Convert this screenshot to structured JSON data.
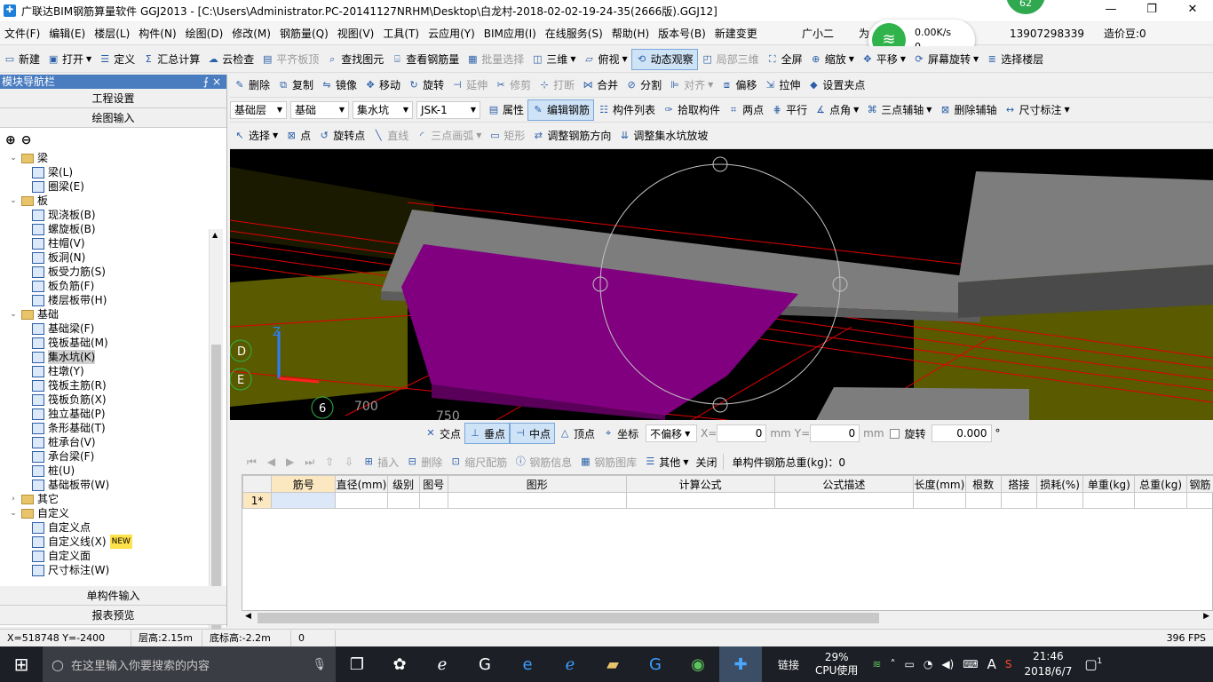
{
  "window": {
    "title": "广联达BIM钢筋算量软件 GGJ2013 - [C:\\Users\\Administrator.PC-20141127NRHM\\Desktop\\白龙村-2018-02-02-19-24-35(2666版).GGJ12]",
    "minimize": "—",
    "restore": "❐",
    "close": "✕",
    "badge": "62"
  },
  "menu": [
    "文件(F)",
    "编辑(E)",
    "楼层(L)",
    "构件(N)",
    "绘图(D)",
    "修改(M)",
    "钢筋量(Q)",
    "视图(V)",
    "工具(T)",
    "云应用(Y)",
    "BIM应用(I)",
    "在线服务(S)",
    "帮助(H)",
    "版本号(B)",
    "新建变更"
  ],
  "menu_right": {
    "user": "广小二",
    "for": "为",
    "phone": "13907298339",
    "cost": "造价豆:0"
  },
  "network": {
    "speed": "0.00K/s",
    "count": "0"
  },
  "toolbar1": [
    {
      "label": "新建",
      "icon": "new-icon"
    },
    {
      "label": "打开",
      "icon": "open-icon",
      "dd": true
    },
    {
      "label": "定义",
      "icon": "define-icon"
    },
    {
      "label": "汇总计算",
      "icon": "sum-icon"
    },
    {
      "label": "云检查",
      "icon": "cloud-check-icon"
    },
    {
      "label": "平齐板顶",
      "icon": "align-top-icon",
      "dis": true
    },
    {
      "label": "查找图元",
      "icon": "find-icon"
    },
    {
      "label": "查看钢筋量",
      "icon": "view-rebar-icon"
    },
    {
      "label": "批量选择",
      "icon": "batch-select-icon",
      "dis": true
    },
    {
      "label": "三维",
      "icon": "3d-icon",
      "dd": true
    },
    {
      "label": "俯视",
      "icon": "top-view-icon",
      "dd": true
    },
    {
      "label": "动态观察",
      "icon": "orbit-icon",
      "active": true
    },
    {
      "label": "局部三维",
      "icon": "local-3d-icon",
      "dis": true
    },
    {
      "label": "全屏",
      "icon": "fullscreen-icon"
    },
    {
      "label": "缩放",
      "icon": "zoom-icon",
      "dd": true
    },
    {
      "label": "平移",
      "icon": "pan-icon",
      "dd": true
    },
    {
      "label": "屏幕旋转",
      "icon": "rotate-screen-icon",
      "dd": true
    },
    {
      "label": "选择楼层",
      "icon": "select-floor-icon"
    }
  ],
  "toolbar2": [
    {
      "label": "删除",
      "icon": "delete-icon"
    },
    {
      "label": "复制",
      "icon": "copy-icon"
    },
    {
      "label": "镜像",
      "icon": "mirror-icon"
    },
    {
      "label": "移动",
      "icon": "move-icon"
    },
    {
      "label": "旋转",
      "icon": "rotate-icon"
    },
    {
      "label": "延伸",
      "icon": "extend-icon",
      "dis": true
    },
    {
      "label": "修剪",
      "icon": "trim-icon",
      "dis": true
    },
    {
      "label": "打断",
      "icon": "break-icon",
      "dis": true
    },
    {
      "label": "合并",
      "icon": "merge-icon"
    },
    {
      "label": "分割",
      "icon": "split-icon"
    },
    {
      "label": "对齐",
      "icon": "align-icon",
      "dis": true,
      "dd": true
    },
    {
      "label": "偏移",
      "icon": "offset-icon"
    },
    {
      "label": "拉伸",
      "icon": "stretch-icon"
    },
    {
      "label": "设置夹点",
      "icon": "grip-icon"
    }
  ],
  "toolbar3": {
    "selects": [
      "基础层",
      "基础",
      "集水坑",
      "JSK-1"
    ],
    "items": [
      {
        "label": "属性",
        "icon": "property-icon"
      },
      {
        "label": "编辑钢筋",
        "icon": "edit-rebar-icon",
        "active": true
      },
      {
        "label": "构件列表",
        "icon": "component-list-icon"
      },
      {
        "label": "拾取构件",
        "icon": "pick-icon"
      },
      {
        "label": "两点",
        "icon": "two-point-icon"
      },
      {
        "label": "平行",
        "icon": "parallel-icon"
      },
      {
        "label": "点角",
        "icon": "point-angle-icon",
        "dd": true
      },
      {
        "label": "三点辅轴",
        "icon": "three-point-axis-icon",
        "dd": true
      },
      {
        "label": "删除辅轴",
        "icon": "delete-axis-icon"
      },
      {
        "label": "尺寸标注",
        "icon": "dimension-icon",
        "dd": true
      }
    ]
  },
  "toolbar4": [
    {
      "label": "选择",
      "icon": "select-icon",
      "dd": true
    },
    {
      "label": "点",
      "icon": "point-icon"
    },
    {
      "label": "旋转点",
      "icon": "rotate-point-icon"
    },
    {
      "label": "直线",
      "icon": "line-icon",
      "dis": true
    },
    {
      "label": "三点画弧",
      "icon": "arc-icon",
      "dis": true,
      "dd": true
    },
    {
      "label": "矩形",
      "icon": "rect-icon",
      "dis": true
    },
    {
      "label": "调整钢筋方向",
      "icon": "adjust-rebar-icon"
    },
    {
      "label": "调整集水坑放坡",
      "icon": "adjust-slope-icon"
    }
  ],
  "nav": {
    "title": "模块导航栏",
    "pin": "⨍",
    "close": "×",
    "top_buttons": [
      "工程设置",
      "绘图输入"
    ],
    "bottom_buttons": [
      "单构件输入",
      "报表预览"
    ],
    "tree": [
      {
        "level": 0,
        "label": "梁",
        "exp": "⌄"
      },
      {
        "level": 1,
        "label": "梁(L)"
      },
      {
        "level": 1,
        "label": "圈梁(E)"
      },
      {
        "level": 0,
        "label": "板",
        "exp": "⌄"
      },
      {
        "level": 1,
        "label": "现浇板(B)"
      },
      {
        "level": 1,
        "label": "螺旋板(B)"
      },
      {
        "level": 1,
        "label": "柱帽(V)"
      },
      {
        "level": 1,
        "label": "板洞(N)"
      },
      {
        "level": 1,
        "label": "板受力筋(S)"
      },
      {
        "level": 1,
        "label": "板负筋(F)"
      },
      {
        "level": 1,
        "label": "楼层板带(H)"
      },
      {
        "level": 0,
        "label": "基础",
        "exp": "⌄"
      },
      {
        "level": 1,
        "label": "基础梁(F)"
      },
      {
        "level": 1,
        "label": "筏板基础(M)"
      },
      {
        "level": 1,
        "label": "集水坑(K)",
        "selected": true
      },
      {
        "level": 1,
        "label": "柱墩(Y)"
      },
      {
        "level": 1,
        "label": "筏板主筋(R)"
      },
      {
        "level": 1,
        "label": "筏板负筋(X)"
      },
      {
        "level": 1,
        "label": "独立基础(P)"
      },
      {
        "level": 1,
        "label": "条形基础(T)"
      },
      {
        "level": 1,
        "label": "桩承台(V)"
      },
      {
        "level": 1,
        "label": "承台梁(F)"
      },
      {
        "level": 1,
        "label": "桩(U)"
      },
      {
        "level": 1,
        "label": "基础板带(W)"
      },
      {
        "level": 0,
        "label": "其它",
        "exp": "›"
      },
      {
        "level": 0,
        "label": "自定义",
        "exp": "⌄"
      },
      {
        "level": 1,
        "label": "自定义点"
      },
      {
        "level": 1,
        "label": "自定义线(X)",
        "new": "NEW"
      },
      {
        "level": 1,
        "label": "自定义面"
      },
      {
        "level": 1,
        "label": "尺寸标注(W)"
      }
    ]
  },
  "canvas": {
    "axis_labels": [
      "D",
      "E",
      "6"
    ],
    "dims": [
      "700",
      "750"
    ],
    "axis_z": "Z"
  },
  "snapbar": {
    "items": [
      {
        "label": "交点",
        "icon": "intersect-icon"
      },
      {
        "label": "垂点",
        "icon": "perpendicular-icon",
        "active": true
      },
      {
        "label": "中点",
        "icon": "midpoint-icon",
        "active": true
      },
      {
        "label": "顶点",
        "icon": "vertex-icon"
      },
      {
        "label": "坐标",
        "icon": "coordinate-icon"
      }
    ],
    "offset": "不偏移",
    "x_label": "X=",
    "x_value": "0",
    "x_unit": "mm",
    "y_label": "Y=",
    "y_value": "0",
    "y_unit": "mm",
    "rotate_label": "旋转",
    "rotate_value": "0.000",
    "rotate_unit": "°"
  },
  "grid_toolbar": {
    "items": [
      {
        "label": "插入",
        "icon": "insert-icon",
        "dis": true
      },
      {
        "label": "删除",
        "icon": "delete-row-icon",
        "dis": true
      },
      {
        "label": "缩尺配筋",
        "icon": "scale-rebar-icon",
        "dis": true
      },
      {
        "label": "钢筋信息",
        "icon": "rebar-info-icon",
        "dis": true
      },
      {
        "label": "钢筋图库",
        "icon": "rebar-lib-icon",
        "dis": true
      },
      {
        "label": "其他",
        "icon": "other-icon",
        "dd": true
      },
      {
        "label": "关闭",
        "icon": ""
      }
    ],
    "weight": "单构件钢筋总重(kg)：0"
  },
  "grid": {
    "columns": [
      "筋号",
      "直径(mm)",
      "级别",
      "图号",
      "图形",
      "计算公式",
      "公式描述",
      "长度(mm)",
      "根数",
      "搭接",
      "损耗(%)",
      "单重(kg)",
      "总重(kg)",
      "钢筋"
    ],
    "row_header": "1*"
  },
  "status": {
    "xy": "X=518748 Y=-2400",
    "floor_height": "层高:2.15m",
    "base_elev": "底标高:-2.2m",
    "zero": "0",
    "fps": "396 FPS"
  },
  "taskbar": {
    "search_placeholder": "在这里输入你要搜索的内容",
    "link": "链接",
    "cpu": "29%",
    "cpu_label": "CPU使用",
    "time": "21:46",
    "date": "2018/6/7",
    "ime": "A",
    "notif": "1"
  },
  "colors": {
    "nav_title": "#4a7cc0",
    "beam": "#7a7a7a",
    "pit": "#800080",
    "olive": "#5a5a00",
    "grid_red": "#e00000"
  }
}
